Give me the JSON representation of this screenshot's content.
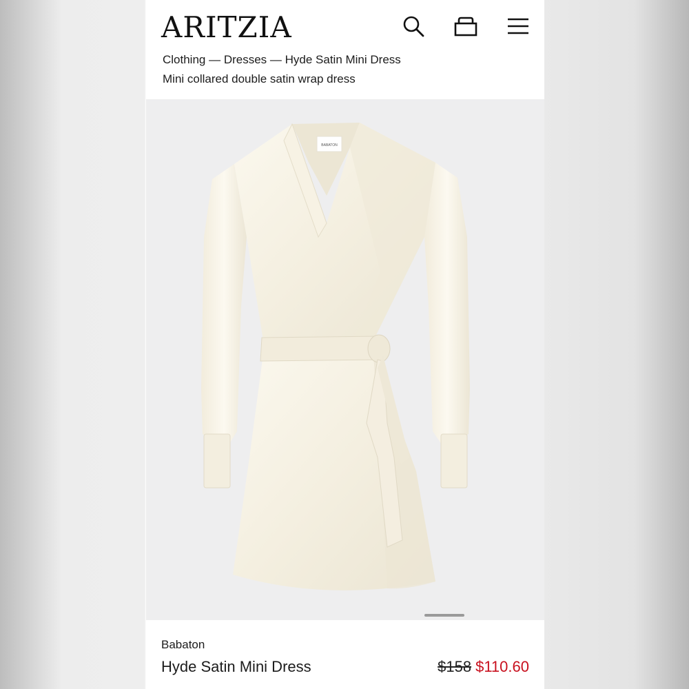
{
  "header": {
    "logo": "ARITZIA",
    "icons": [
      "search-icon",
      "bag-icon",
      "menu-icon"
    ]
  },
  "breadcrumb": "Clothing — Dresses — Hyde Satin Mini Dress",
  "subtitle": "Mini collared double satin wrap dress",
  "image": {
    "label_text": "BABATON",
    "carousel_position": 1
  },
  "product": {
    "brand": "Babaton",
    "name": "Hyde Satin Mini Dress",
    "price_original": "$158",
    "price_sale": "$110.60",
    "sale_color": "#c8101e"
  }
}
